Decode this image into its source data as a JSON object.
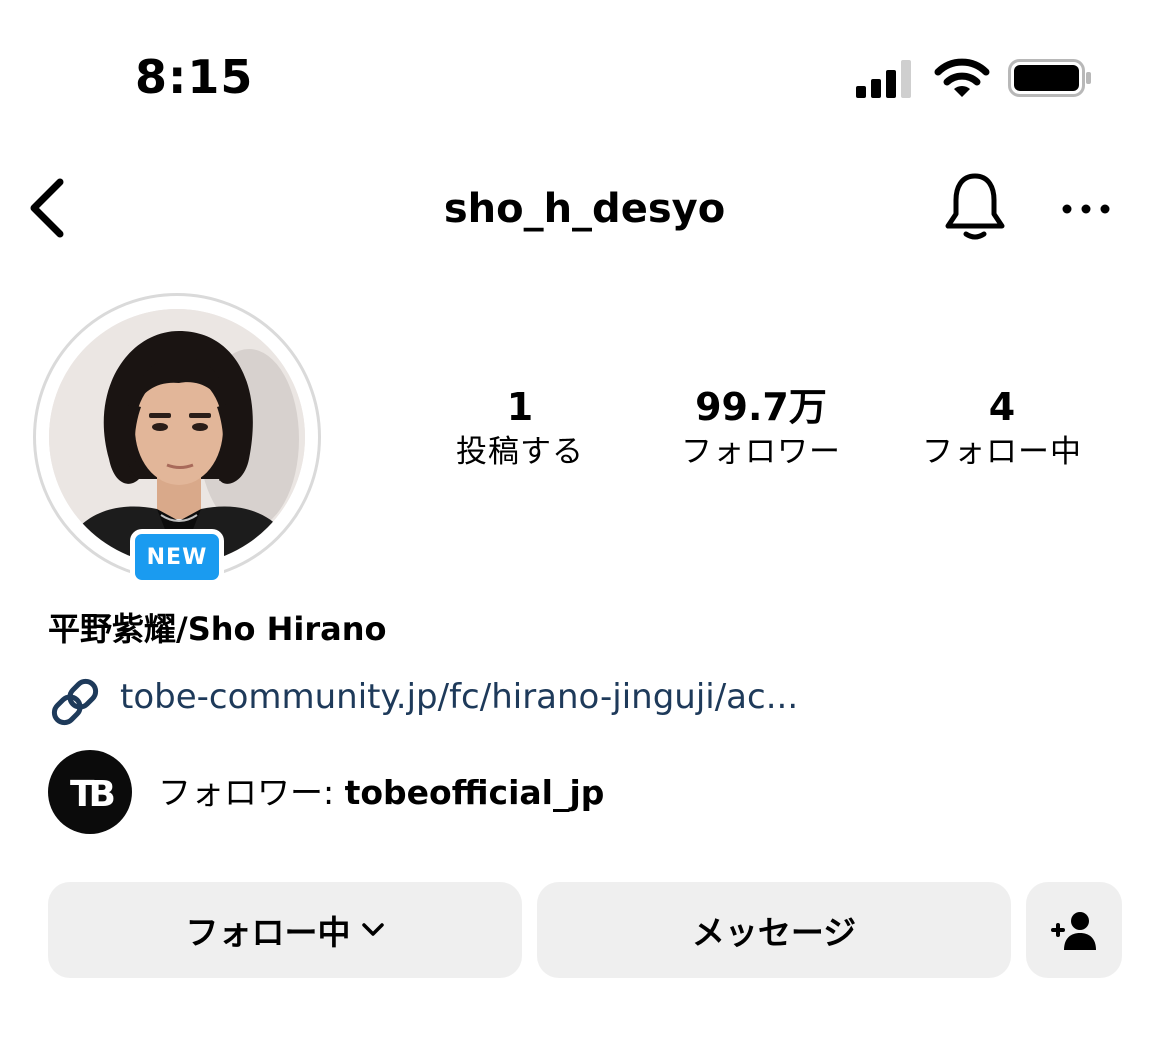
{
  "status_bar": {
    "time": "8:15"
  },
  "header": {
    "username": "sho_h_desyo"
  },
  "profile": {
    "badge": "NEW",
    "full_name": "平野紫耀/Sho Hirano",
    "link": "tobe-community.jp/fc/hirano-jinguji/ac...",
    "followed_by_prefix": "フォロワー: ",
    "followed_by_user": "tobeofficial_jp"
  },
  "stats": [
    {
      "value": "1",
      "label": "投稿する"
    },
    {
      "value": "99.7万",
      "label": "フォロワー"
    },
    {
      "value": "4",
      "label": "フォロー中"
    }
  ],
  "buttons": {
    "following": "フォロー中",
    "message": "メッセージ"
  },
  "colors": {
    "badge_blue": "#1a9bf0",
    "link_blue": "#1e3a5a",
    "button_gray": "#efefef"
  },
  "icons": [
    "back-chevron-icon",
    "bell-icon",
    "more-icon",
    "link-icon",
    "chevron-down-icon",
    "add-person-icon"
  ]
}
